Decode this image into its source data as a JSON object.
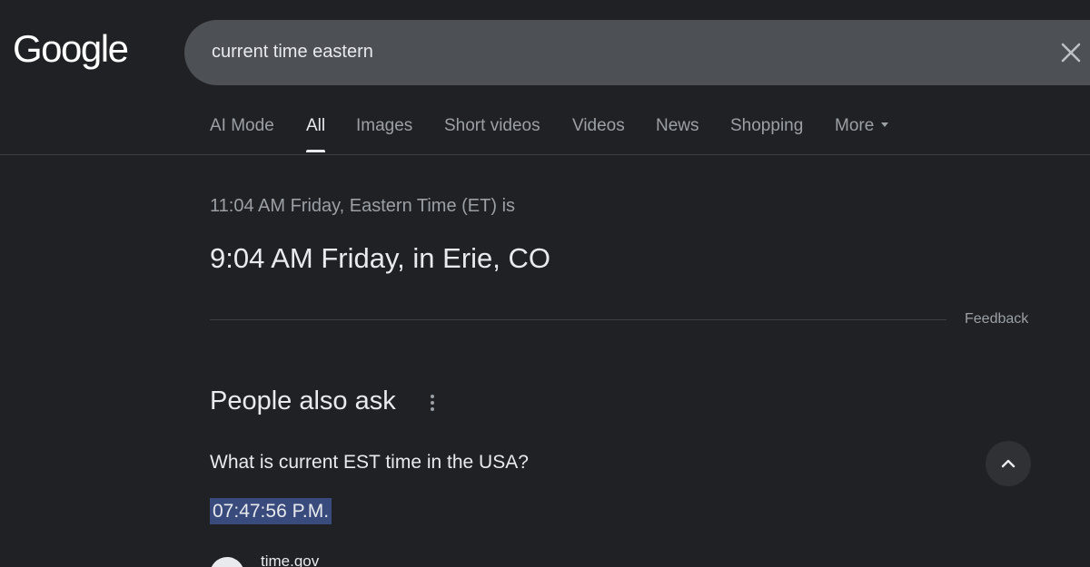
{
  "header": {
    "logo_text": "Google",
    "search_value": "current time eastern"
  },
  "tabs": [
    {
      "label": "AI Mode",
      "active": false
    },
    {
      "label": "All",
      "active": true
    },
    {
      "label": "Images",
      "active": false
    },
    {
      "label": "Short videos",
      "active": false
    },
    {
      "label": "Videos",
      "active": false
    },
    {
      "label": "News",
      "active": false
    },
    {
      "label": "Shopping",
      "active": false
    },
    {
      "label": "More",
      "active": false
    }
  ],
  "time_result": {
    "source_line": "11:04 AM Friday, Eastern Time (ET) is",
    "converted_line": "9:04 AM Friday, in Erie, CO",
    "feedback_label": "Feedback"
  },
  "people_also_ask": {
    "title": "People also ask",
    "question": "What is current EST time in the USA?",
    "answer": "07:47:56 P.M.",
    "source": "time.gov"
  },
  "colors": {
    "background": "#202124",
    "search_box": "#4d5156",
    "highlight": "#394a7d",
    "text_primary": "#e8eaed",
    "text_secondary": "#9aa0a6"
  },
  "icons": {
    "clear": "close-icon",
    "more_caret": "caret-down-icon",
    "paa_menu": "more-vert-icon",
    "collapse": "chevron-up-icon"
  }
}
